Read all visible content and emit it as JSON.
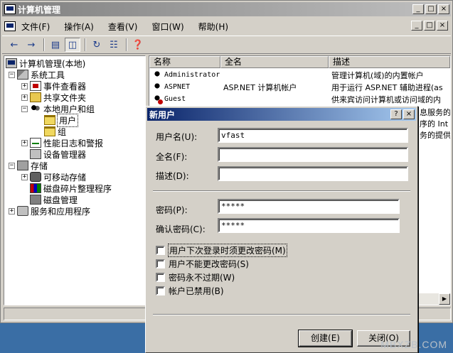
{
  "window": {
    "title": "计算机管理"
  },
  "menu": [
    "文件(F)",
    "操作(A)",
    "查看(V)",
    "窗口(W)",
    "帮助(H)"
  ],
  "window_buttons": {
    "minimize": "_",
    "restore": "□",
    "close": "×"
  },
  "tree": {
    "root": "计算机管理(本地)",
    "system_tools": "系统工具",
    "event_viewer": "事件查看器",
    "shared_folders": "共享文件夹",
    "local_users_groups": "本地用户和组",
    "users": "用户",
    "groups": "组",
    "perf_logs": "性能日志和警报",
    "device_manager": "设备管理器",
    "storage": "存储",
    "removable_storage": "可移动存储",
    "defrag": "磁盘碎片整理程序",
    "disk_mgmt": "磁盘管理",
    "services_apps": "服务和应用程序"
  },
  "list": {
    "columns": [
      "名称",
      "全名",
      "描述"
    ],
    "rows": [
      {
        "name": "Administrator",
        "fullname": "",
        "desc": "管理计算机(域)的内置帐户"
      },
      {
        "name": "ASPNET",
        "fullname": "ASP.NET 计算机帐户",
        "desc": "用于运行 ASP.NET 辅助进程(as"
      },
      {
        "name": "Guest",
        "fullname": "",
        "desc": "供来宾访问计算机或访问域的内"
      }
    ],
    "overflow_fragments": [
      "息服务的",
      "序的 Int",
      "务的提供"
    ]
  },
  "dialog": {
    "title": "新用户",
    "help_btn": "?",
    "close_btn": "×",
    "username_label": "用户名(U):",
    "username_value": "vfast",
    "fullname_label": "全名(F):",
    "fullname_value": "",
    "desc_label": "描述(D):",
    "desc_value": "",
    "password_label": "密码(P):",
    "password_value": "*****",
    "confirm_label": "确认密码(C):",
    "confirm_value": "*****",
    "checkboxes": [
      {
        "label": "用户下次登录时须更改密码(M)",
        "checked": false
      },
      {
        "label": "用户不能更改密码(S)",
        "checked": false
      },
      {
        "label": "密码永不过期(W)",
        "checked": false
      },
      {
        "label": "帐户已禁用(B)",
        "checked": false
      }
    ],
    "create_btn": "创建(E)",
    "close_label": "关闭(O)"
  },
  "watermark": "MBXZB.COM"
}
